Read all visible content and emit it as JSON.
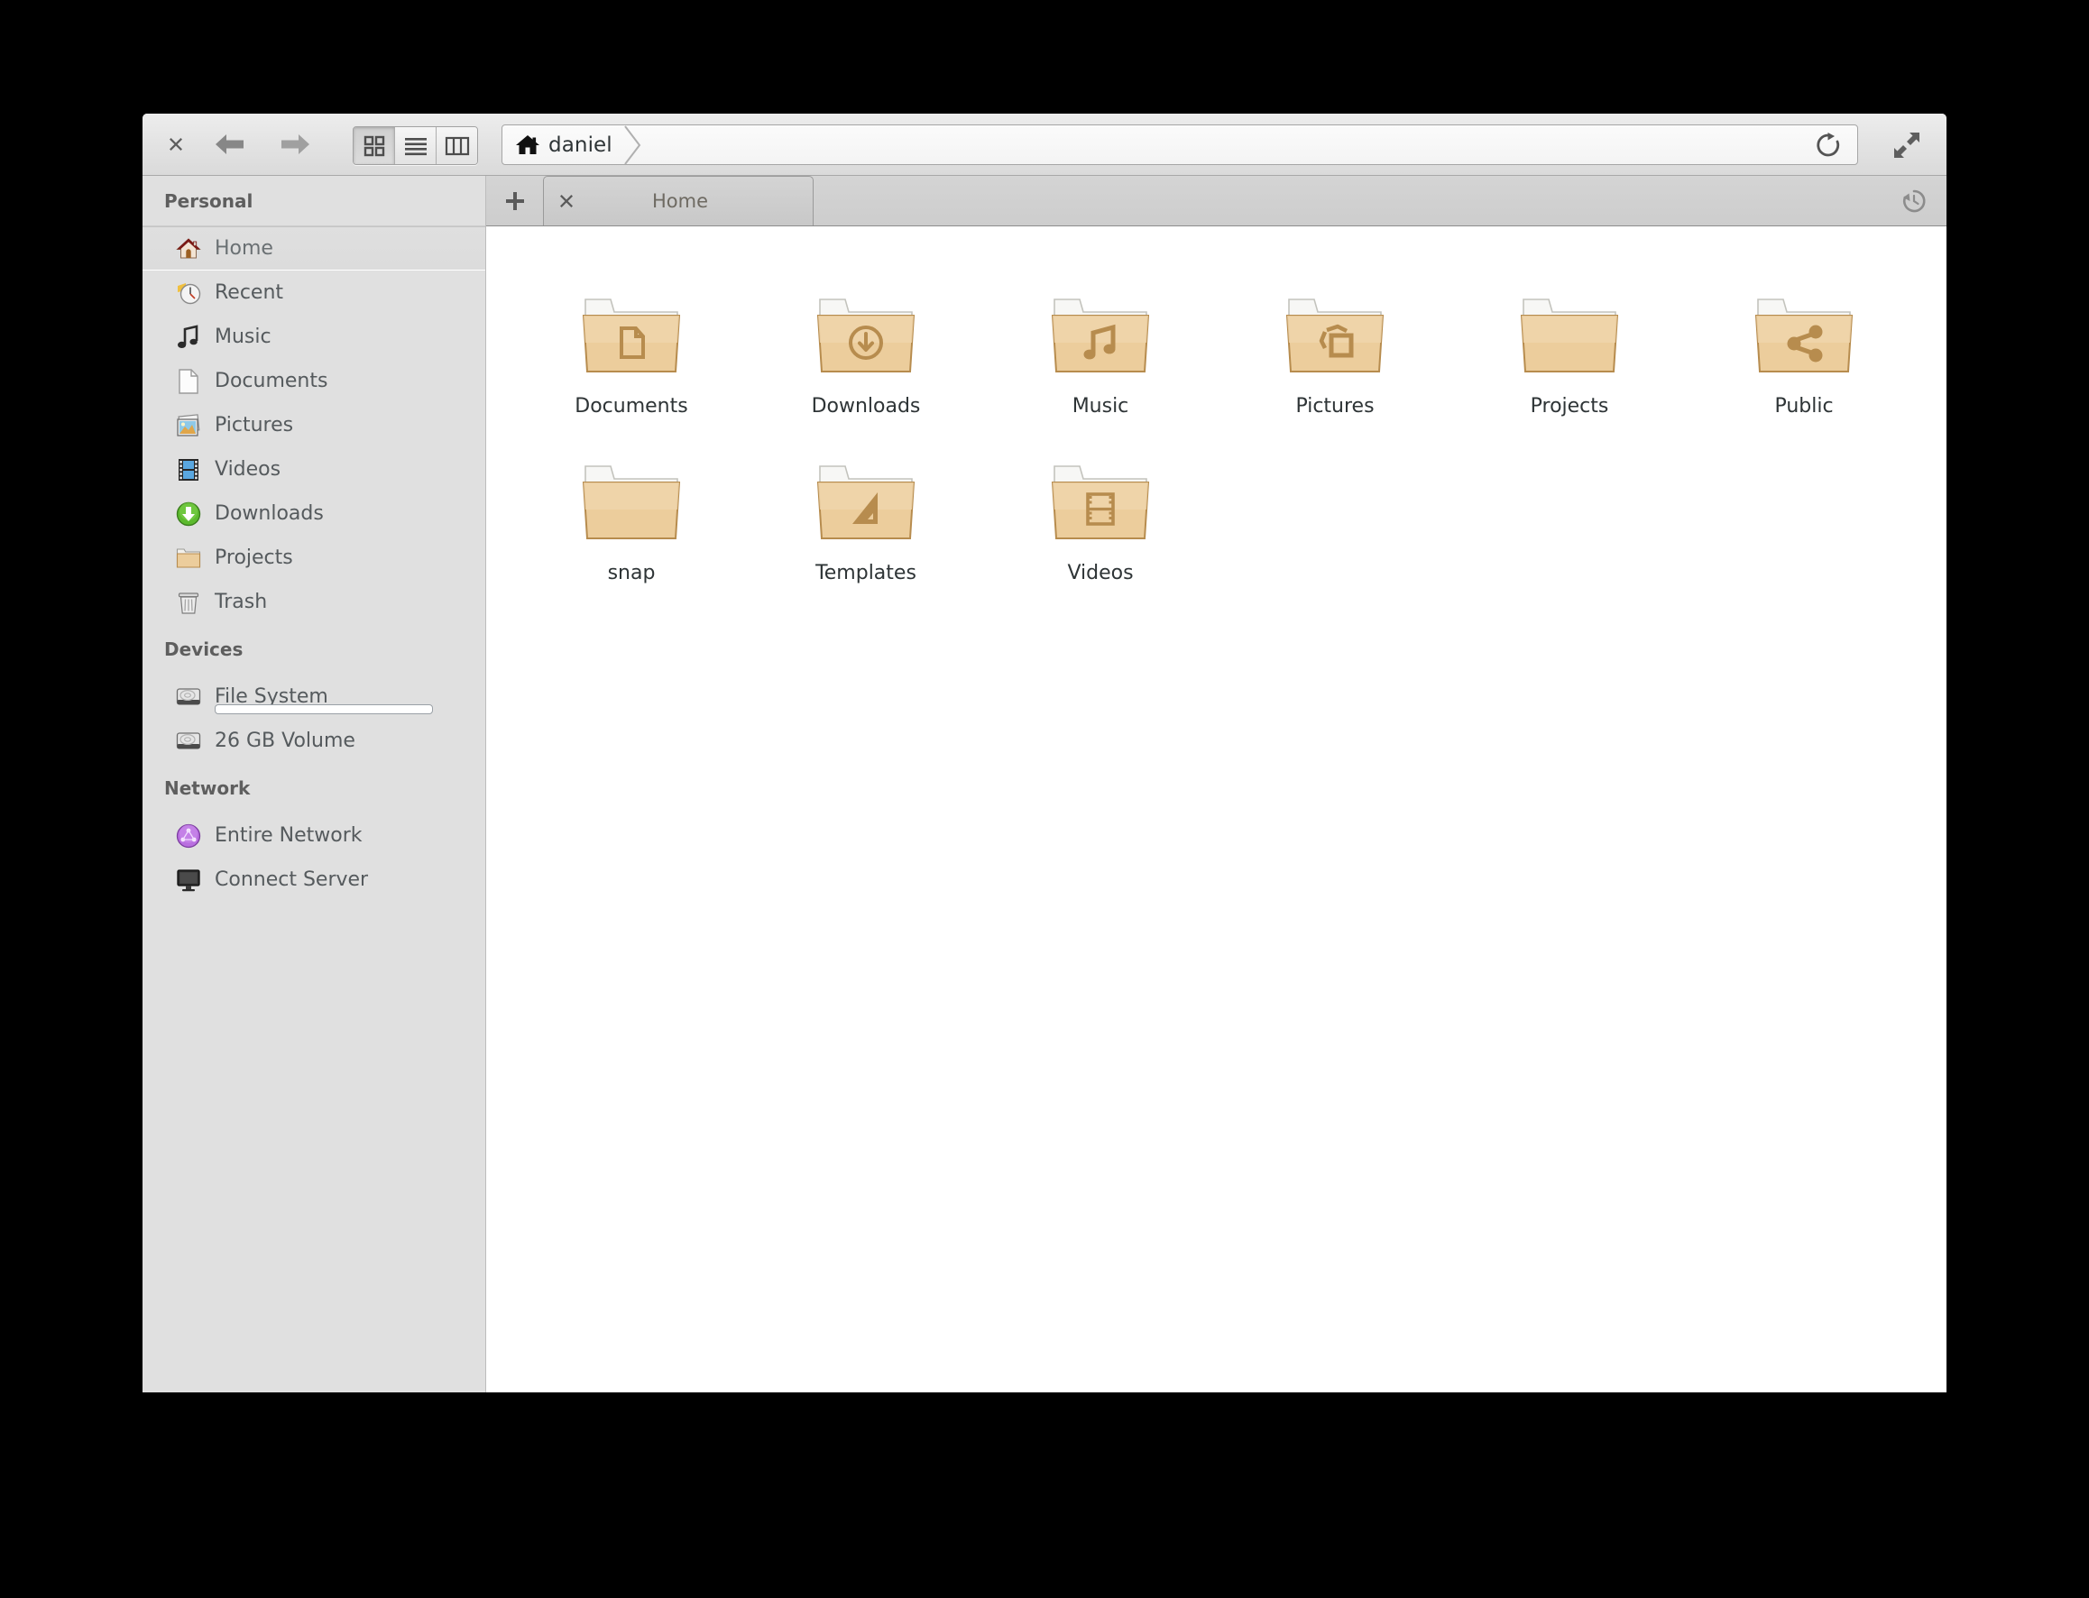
{
  "window": {
    "title": "Home",
    "background_color": "#ffffff"
  },
  "toolbar": {
    "close_label": "close-window",
    "back_label": "Back",
    "forward_label": "Forward",
    "view_modes": [
      {
        "name": "icon-view",
        "label": "Icon View",
        "active": true
      },
      {
        "name": "list-view",
        "label": "List View",
        "active": false
      },
      {
        "name": "column-view",
        "label": "Compact View",
        "active": false
      }
    ],
    "path": {
      "crumb_label": "daniel",
      "crumb_icon": "home-icon",
      "separator_icon": "chevron-right-icon"
    },
    "reload_label": "Reload",
    "reload_icon": "reload-icon",
    "maximize_label": "Maximize",
    "maximize_icon": "expand-arrows-icon"
  },
  "tabbar": {
    "new_tab_label": "+",
    "new_tab_icon": "plus-icon",
    "tabs": [
      {
        "label": "Home",
        "close_icon": "close-icon",
        "active": true
      }
    ],
    "history_label": "History",
    "history_icon": "history-clock-icon"
  },
  "sidebar": {
    "sections": [
      {
        "title": "Personal",
        "items": [
          {
            "label": "Home",
            "icon": "home-icon",
            "selected": true
          },
          {
            "label": "Recent",
            "icon": "recent-clock-icon",
            "selected": false
          },
          {
            "label": "Music",
            "icon": "music-note-icon",
            "selected": false
          },
          {
            "label": "Documents",
            "icon": "document-page-icon",
            "selected": false
          },
          {
            "label": "Pictures",
            "icon": "pictures-photo-icon",
            "selected": false
          },
          {
            "label": "Videos",
            "icon": "video-filmstrip-icon",
            "selected": false
          },
          {
            "label": "Downloads",
            "icon": "download-arrow-icon",
            "selected": false
          },
          {
            "label": "Projects",
            "icon": "folder-icon",
            "selected": false
          },
          {
            "label": "Trash",
            "icon": "trash-can-icon",
            "selected": false
          }
        ]
      },
      {
        "title": "Devices",
        "items": [
          {
            "label": "File System",
            "icon": "hard-drive-icon",
            "selected": false,
            "capacity_percent": 3
          },
          {
            "label": "26 GB Volume",
            "icon": "hard-drive-icon",
            "selected": false
          }
        ]
      },
      {
        "title": "Network",
        "items": [
          {
            "label": "Entire Network",
            "icon": "network-globe-icon",
            "selected": false
          },
          {
            "label": "Connect Server",
            "icon": "monitor-server-icon",
            "selected": false
          }
        ]
      }
    ]
  },
  "files": [
    {
      "label": "Documents",
      "icon": "folder-documents-icon"
    },
    {
      "label": "Downloads",
      "icon": "folder-downloads-icon"
    },
    {
      "label": "Music",
      "icon": "folder-music-icon"
    },
    {
      "label": "Pictures",
      "icon": "folder-pictures-icon"
    },
    {
      "label": "Projects",
      "icon": "folder-plain-icon"
    },
    {
      "label": "Public",
      "icon": "folder-public-icon"
    },
    {
      "label": "snap",
      "icon": "folder-plain-icon"
    },
    {
      "label": "Templates",
      "icon": "folder-templates-icon"
    },
    {
      "label": "Videos",
      "icon": "folder-videos-icon"
    }
  ],
  "colors": {
    "folder_front": "#e9c893",
    "folder_front_light": "#f0d6ad",
    "folder_border": "#b78c4e",
    "folder_emblem": "#b78c4e",
    "folder_back": "#f7f7f5",
    "toolbar_bg": "#e4e4e4",
    "sidebar_bg": "#e0e0e0",
    "tabbar_bg": "#d0d0d0",
    "text": "#2e3436",
    "sidebar_text": "#555a5d",
    "capacity_fill": "#5a9fdc"
  }
}
